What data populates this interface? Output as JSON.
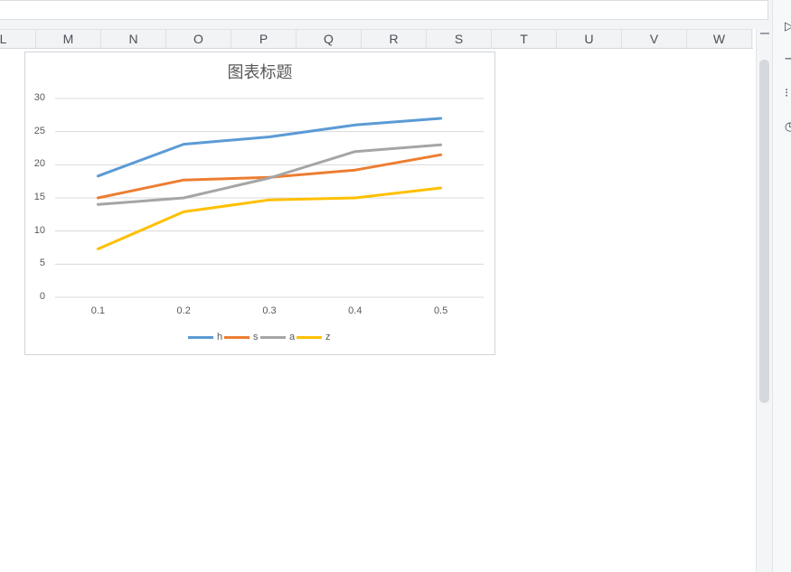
{
  "columns": [
    "L",
    "M",
    "N",
    "O",
    "P",
    "Q",
    "R",
    "S",
    "T",
    "U",
    "V",
    "W"
  ],
  "side_icons": [
    "cursor-icon",
    "slider-icon",
    "grid-icon",
    "clock-icon"
  ],
  "chart_data": {
    "type": "line",
    "title": "图表标题",
    "categories": [
      "0.1",
      "0.2",
      "0.3",
      "0.4",
      "0.5"
    ],
    "ylim": [
      0,
      30
    ],
    "yticks": [
      "0",
      "5",
      "10",
      "15",
      "20",
      "25",
      "30"
    ],
    "grid": true,
    "legend_position": "bottom",
    "series": [
      {
        "name": "h",
        "color": "#5b9bd5",
        "values": [
          18.3,
          23.1,
          24.2,
          26.0,
          27.0
        ]
      },
      {
        "name": "s",
        "color": "#ed7d31",
        "values": [
          15.0,
          17.7,
          18.1,
          19.2,
          21.5
        ]
      },
      {
        "name": "a",
        "color": "#a5a5a5",
        "values": [
          14.0,
          15.0,
          18.0,
          22.0,
          23.0
        ]
      },
      {
        "name": "z",
        "color": "#ffc000",
        "values": [
          7.3,
          12.9,
          14.7,
          15.0,
          16.5
        ]
      }
    ]
  }
}
